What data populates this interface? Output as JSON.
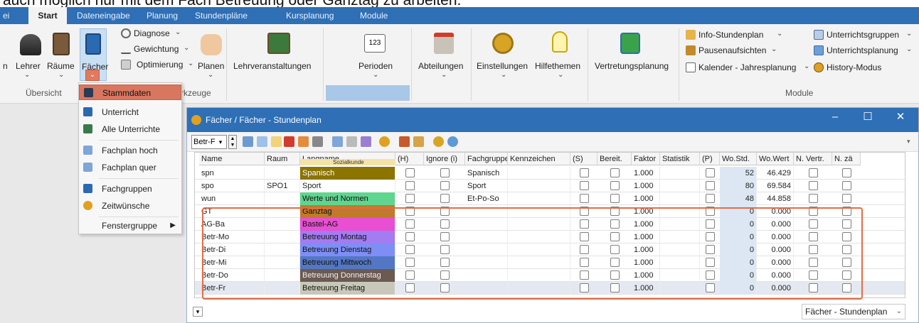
{
  "caption": "auch möglich nur mit dem Fach Betreuung oder Ganztag zu arbeiten.",
  "tabs": [
    {
      "label": "ei"
    },
    {
      "label": "Start"
    },
    {
      "label": "Dateneingabe"
    },
    {
      "label": "Planung"
    },
    {
      "label": "Stundenpläne"
    },
    {
      "label": "Kursplanung"
    },
    {
      "label": "Module"
    }
  ],
  "ribbon": {
    "lehrer": "Lehrer",
    "raeume": "Räume",
    "faecher": "Fächer",
    "n": "n",
    "uebersicht": "Übersicht",
    "diagnose": "Diagnose",
    "gewichtung": "Gewichtung",
    "optimierung": "Optimierung",
    "planen": "Planen",
    "werkzeuge": "rkzeuge",
    "lehrveranstaltungen": "Lehrveranstaltungen",
    "perioden": "Perioden",
    "abteilungen": "Abteilungen",
    "einstellungen": "Einstellungen",
    "hilfethemen": "Hilfethemen",
    "vertretungsplanung": "Vertretungsplanung",
    "info_stundenplan": "Info-Stundenplan",
    "pausenaufsichten": "Pausenaufsichten",
    "kalender": "Kalender - Jahresplanung",
    "history": "History-Modus",
    "unterrichtsgruppen": "Unterrichtsgruppen",
    "unterrichtsplanung": "Unterrichtsplanung",
    "module": "Module",
    "perioden_icon_text": "123"
  },
  "menu": {
    "items": [
      {
        "label": "Stammdaten"
      },
      {
        "label": "Unterricht"
      },
      {
        "label": "Alle Unterrichte"
      },
      {
        "label": "Fachplan hoch"
      },
      {
        "label": "Fachplan quer"
      },
      {
        "label": "Fachgruppen"
      },
      {
        "label": "Zeitwünsche"
      },
      {
        "label": "Fenstergruppe"
      }
    ]
  },
  "window": {
    "title": "Fächer / Fächer - Stundenplan",
    "minimize": "–",
    "maximize": "☐",
    "close": "✕",
    "selector_value": "Betr-F",
    "status_select": "Fächer - Stundenplan"
  },
  "columns": [
    {
      "label": "Name"
    },
    {
      "label": "Raum"
    },
    {
      "label": "Langname"
    },
    {
      "label": "(H)"
    },
    {
      "label": "Ignore (i)"
    },
    {
      "label": "Fachgruppe"
    },
    {
      "label": "Kennzeichen"
    },
    {
      "label": "(S)"
    },
    {
      "label": "Bereit."
    },
    {
      "label": "Faktor"
    },
    {
      "label": "Statistik"
    },
    {
      "label": "(P)"
    },
    {
      "label": "Wo.Std."
    },
    {
      "label": "Wo.Wert"
    },
    {
      "label": "N. Vertr."
    },
    {
      "label": "N. zä"
    }
  ],
  "header_overlay_text": "Sozialkunde",
  "rows": [
    {
      "name": "spn",
      "raum": "",
      "langname": "Spanisch",
      "color": "#8b7400",
      "text_color": "#ffffff",
      "fachgruppe": "Spanisch",
      "faktor": "1.000",
      "wostd": "52",
      "wowert": "46.429"
    },
    {
      "name": "spo",
      "raum": "SPO1",
      "langname": "Sport",
      "color": "#ffffff",
      "text_color": "#222222",
      "fachgruppe": "Sport",
      "faktor": "1.000",
      "wostd": "80",
      "wowert": "69.584"
    },
    {
      "name": "wun",
      "raum": "",
      "langname": "Werte und Normen",
      "color": "#5fd58f",
      "text_color": "#111111",
      "fachgruppe": "Et-Po-So",
      "faktor": "1.000",
      "wostd": "48",
      "wowert": "44.858"
    },
    {
      "name": "GT",
      "raum": "",
      "langname": "Ganztag",
      "color": "#c07a2a",
      "text_color": "#111111",
      "fachgruppe": "",
      "faktor": "1.000",
      "wostd": "0",
      "wowert": "0.000"
    },
    {
      "name": "AG-Ba",
      "raum": "",
      "langname": "Bastel-AG",
      "color": "#e84fd2",
      "text_color": "#111111",
      "fachgruppe": "",
      "faktor": "1.000",
      "wostd": "0",
      "wowert": "0.000"
    },
    {
      "name": "Betr-Mo",
      "raum": "",
      "langname": "Betreuung Montag",
      "color": "#a27cf0",
      "text_color": "#111111",
      "fachgruppe": "",
      "faktor": "1.000",
      "wostd": "0",
      "wowert": "0.000"
    },
    {
      "name": "Betr-Di",
      "raum": "",
      "langname": "Betreuung Dienstag",
      "color": "#7e8ef5",
      "text_color": "#111111",
      "fachgruppe": "",
      "faktor": "1.000",
      "wostd": "0",
      "wowert": "0.000"
    },
    {
      "name": "Betr-Mi",
      "raum": "",
      "langname": "Betreuung Mittwoch",
      "color": "#5477c4",
      "text_color": "#111111",
      "fachgruppe": "",
      "faktor": "1.000",
      "wostd": "0",
      "wowert": "0.000"
    },
    {
      "name": "Betr-Do",
      "raum": "",
      "langname": "Betreuung Donnerstag",
      "color": "#6b5a52",
      "text_color": "#f0f0f0",
      "fachgruppe": "",
      "faktor": "1.000",
      "wostd": "0",
      "wowert": "0.000"
    },
    {
      "name": "Betr-Fr",
      "raum": "",
      "langname": "Betreuung Freitag",
      "color": "#c7c8b9",
      "text_color": "#111111",
      "fachgruppe": "",
      "faktor": "1.000",
      "wostd": "0",
      "wowert": "0.000"
    }
  ]
}
